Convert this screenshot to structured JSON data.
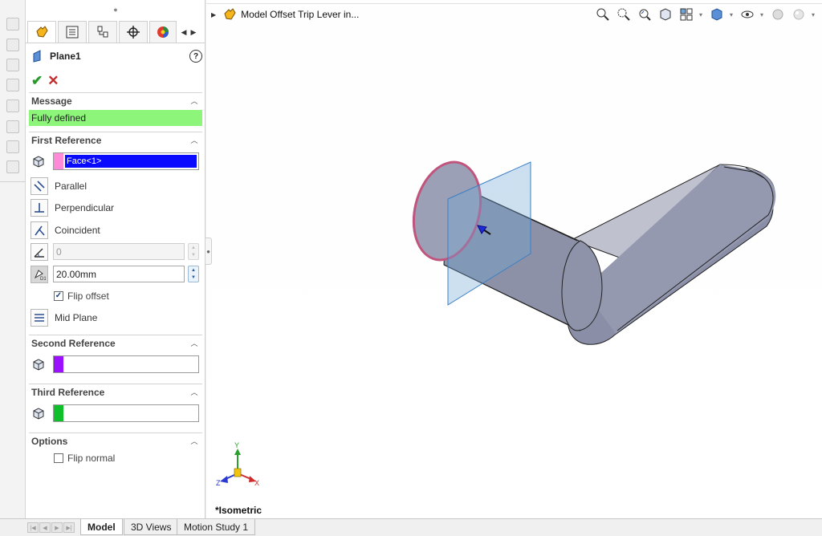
{
  "panel": {
    "title": "Plane1",
    "help_symbol": "?",
    "message_section": {
      "label": "Message",
      "text": "Fully defined"
    },
    "first_reference": {
      "label": "First Reference",
      "selection": "Face<1>",
      "swatch_color": "#ff8ad8",
      "options": [
        {
          "label": "Parallel",
          "icon": "parallel-icon"
        },
        {
          "label": "Perpendicular",
          "icon": "perpendicular-icon"
        },
        {
          "label": "Coincident",
          "icon": "coincident-icon"
        }
      ],
      "angle_value": "0",
      "distance_value": "20.00mm",
      "flip_offset_label": "Flip offset",
      "flip_offset_checked": true,
      "mid_plane_label": "Mid Plane"
    },
    "second_reference": {
      "label": "Second Reference",
      "swatch_color": "#9a10ff"
    },
    "third_reference": {
      "label": "Third Reference",
      "swatch_color": "#10c02a"
    },
    "options_section": {
      "label": "Options",
      "flip_normal_label": "Flip normal",
      "flip_normal_checked": false
    }
  },
  "graphics": {
    "tree_item": "Model Offset Trip Lever in...",
    "view_name": "*Isometric",
    "triad": {
      "y": "Y",
      "x": "X",
      "z": "Z"
    }
  },
  "bottom_tabs": [
    {
      "label": "Model",
      "active": true
    },
    {
      "label": "3D Views",
      "active": false
    },
    {
      "label": "Motion Study 1",
      "active": false
    }
  ],
  "colors": {
    "message_ok": "#8cf57a",
    "selection_highlight": "#0a0aff",
    "part_body": "#8e92a6",
    "plane_preview": "#6fa6d8",
    "selected_face_edge": "#c0547c"
  }
}
